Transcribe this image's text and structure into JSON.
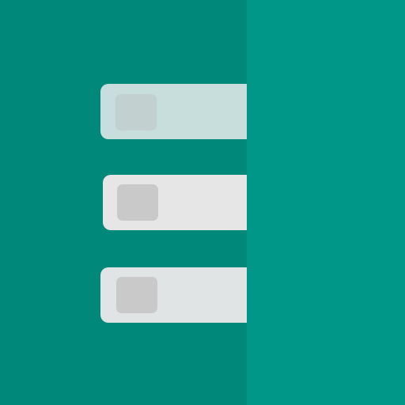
{
  "icon": {
    "name": "list-icon",
    "colors": {
      "left_panel": "#00897b",
      "right_panel": "#009688",
      "row_top": "#c7dedd",
      "row_middle": "#e6e6e6",
      "row_bottom": "#e1e4e4",
      "square_top": "#c3d0d0",
      "square": "#c9c9c9"
    },
    "rows": [
      "row-1",
      "row-2",
      "row-3"
    ]
  }
}
